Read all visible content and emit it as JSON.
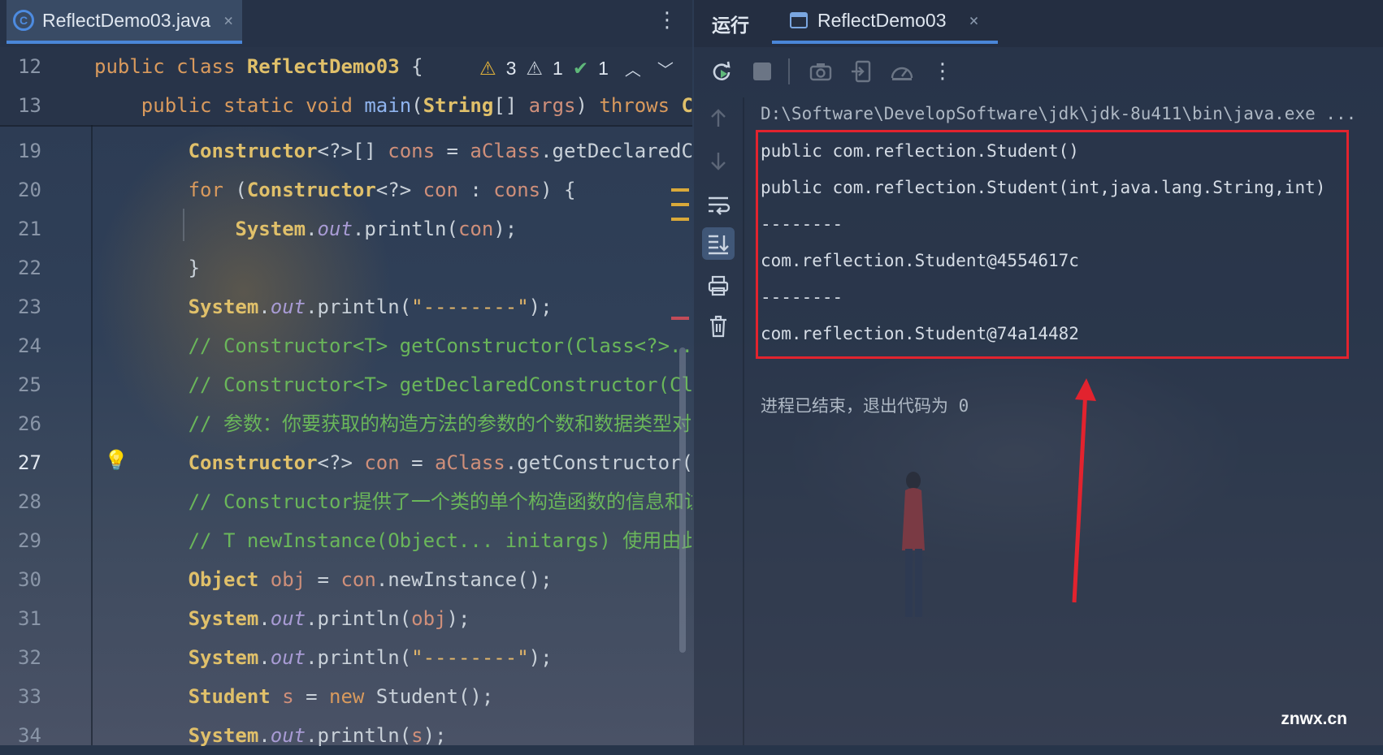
{
  "editor": {
    "tab_label": "ReflectDemo03.java",
    "tab_close": "×",
    "more_label": "⋮",
    "inspections": {
      "warnings": "3",
      "weak_warnings": "1",
      "ok": "1"
    },
    "lines": [
      {
        "num": "12",
        "tokens": [
          [
            "kw",
            "public "
          ],
          [
            "kw",
            "class "
          ],
          [
            "ty",
            "ReflectDemo03 "
          ],
          [
            "pl",
            "{"
          ]
        ]
      },
      {
        "num": "13",
        "tokens": [
          [
            "kw",
            "    public "
          ],
          [
            "kw",
            "static "
          ],
          [
            "kw",
            "void "
          ],
          [
            "fn",
            "main"
          ],
          [
            "pl",
            "("
          ],
          [
            "ty",
            "String"
          ],
          [
            "pl",
            "[] "
          ],
          [
            "vr",
            "args"
          ],
          [
            "pl",
            ") "
          ],
          [
            "kw",
            "throws "
          ],
          [
            "ty",
            "Cla"
          ]
        ]
      },
      {
        "num": "19",
        "tokens": [
          [
            "ty",
            "        Constructor"
          ],
          [
            "pl",
            "<?>[] "
          ],
          [
            "vr",
            "cons "
          ],
          [
            "pl",
            "= "
          ],
          [
            "vr",
            "aClass"
          ],
          [
            "pl",
            ".getDeclaredCon"
          ]
        ]
      },
      {
        "num": "20",
        "tokens": [
          [
            "kw",
            "        for "
          ],
          [
            "pl",
            "("
          ],
          [
            "ty",
            "Constructor"
          ],
          [
            "pl",
            "<?> "
          ],
          [
            "vr",
            "con "
          ],
          [
            "pl",
            ": "
          ],
          [
            "vr",
            "cons"
          ],
          [
            "pl",
            ") {"
          ]
        ]
      },
      {
        "num": "21",
        "tokens": [
          [
            "ty",
            "            System"
          ],
          [
            "pl",
            "."
          ],
          [
            "it",
            "out"
          ],
          [
            "pl",
            ".println("
          ],
          [
            "vr",
            "con"
          ],
          [
            "pl",
            ");"
          ]
        ]
      },
      {
        "num": "22",
        "tokens": [
          [
            "pl",
            "        }"
          ]
        ]
      },
      {
        "num": "23",
        "tokens": [
          [
            "ty",
            "        System"
          ],
          [
            "pl",
            "."
          ],
          [
            "it",
            "out"
          ],
          [
            "pl",
            ".println("
          ],
          [
            "st",
            "\"--------\""
          ],
          [
            "pl",
            ");"
          ]
        ]
      },
      {
        "num": "24",
        "tokens": [
          [
            "cm",
            "        // Constructor<T> getConstructor(Class<?>..."
          ]
        ]
      },
      {
        "num": "25",
        "tokens": [
          [
            "cm",
            "        // Constructor<T> getDeclaredConstructor(Cla"
          ]
        ]
      },
      {
        "num": "26",
        "tokens": [
          [
            "cm",
            "        // 参数：你要获取的构造方法的参数的个数和数据类型对应的"
          ]
        ]
      },
      {
        "num": "27",
        "tokens": [
          [
            "ty",
            "        Constructor"
          ],
          [
            "pl",
            "<?> "
          ],
          [
            "vr",
            "con "
          ],
          [
            "pl",
            "= "
          ],
          [
            "vr",
            "aClass"
          ],
          [
            "pl",
            ".getConstructor("
          ]
        ]
      },
      {
        "num": "28",
        "tokens": [
          [
            "cm",
            "        // Constructor提供了一个类的单个构造函数的信息和访问"
          ]
        ]
      },
      {
        "num": "29",
        "tokens": [
          [
            "cm",
            "        // T newInstance(Object... initargs) 使用由此"
          ]
        ]
      },
      {
        "num": "30",
        "tokens": [
          [
            "ty",
            "        Object "
          ],
          [
            "vr",
            "obj "
          ],
          [
            "pl",
            "= "
          ],
          [
            "vr",
            "con"
          ],
          [
            "pl",
            ".newInstance();"
          ]
        ]
      },
      {
        "num": "31",
        "tokens": [
          [
            "ty",
            "        System"
          ],
          [
            "pl",
            "."
          ],
          [
            "it",
            "out"
          ],
          [
            "pl",
            ".println("
          ],
          [
            "vr",
            "obj"
          ],
          [
            "pl",
            ");"
          ]
        ]
      },
      {
        "num": "32",
        "tokens": [
          [
            "ty",
            "        System"
          ],
          [
            "pl",
            "."
          ],
          [
            "it",
            "out"
          ],
          [
            "pl",
            ".println("
          ],
          [
            "st",
            "\"--------\""
          ],
          [
            "pl",
            ");"
          ]
        ]
      },
      {
        "num": "33",
        "tokens": [
          [
            "ty",
            "        Student "
          ],
          [
            "vr",
            "s "
          ],
          [
            "pl",
            "= "
          ],
          [
            "kw",
            "new "
          ],
          [
            "pl",
            "Student();"
          ]
        ]
      },
      {
        "num": "34",
        "tokens": [
          [
            "ty",
            "        System"
          ],
          [
            "pl",
            "."
          ],
          [
            "it",
            "out"
          ],
          [
            "pl",
            ".println("
          ],
          [
            "vr",
            "s"
          ],
          [
            "pl",
            ");"
          ]
        ]
      }
    ]
  },
  "run": {
    "title": "运行",
    "tab_label": "ReflectDemo03",
    "tab_close": "×",
    "command": "D:\\Software\\DevelopSoftware\\jdk\\jdk-8u411\\bin\\java.exe ...",
    "output": [
      "public com.reflection.Student()",
      "public com.reflection.Student(int,java.lang.String,int)",
      "--------",
      "com.reflection.Student@4554617c",
      "--------",
      "com.reflection.Student@74a14482"
    ],
    "exit_message": "进程已结束，退出代码为 0"
  },
  "watermark": "znwx.cn",
  "colors": {
    "accent": "#4a86d8",
    "highlight_box": "#e2232e"
  }
}
